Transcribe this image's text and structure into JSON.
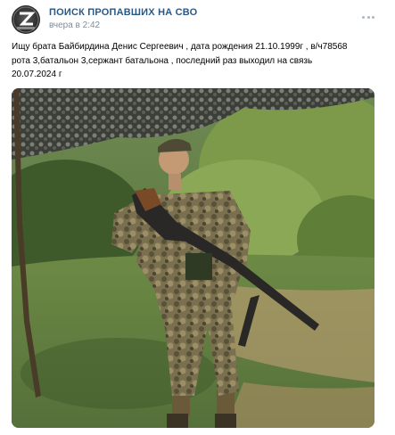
{
  "group": {
    "name": "ПОИСК ПРОПАВШИХ НА СВО",
    "time": "вчера в 2:42",
    "avatar_text": "Z"
  },
  "post": {
    "text_lines": [
      "Ищу брата Байбирдина Денис Сергеевич , дата рождения 21.10.1999г , в/ч78568",
      "рота 3,батальон 3,сержант батальона , последний раз выходил на связь",
      "20.07.2024 г"
    ]
  },
  "icons": {
    "more": "more-horizontal-icon"
  },
  "colors": {
    "group_name": "#2a5885",
    "time": "#818c99",
    "text": "#000000"
  }
}
